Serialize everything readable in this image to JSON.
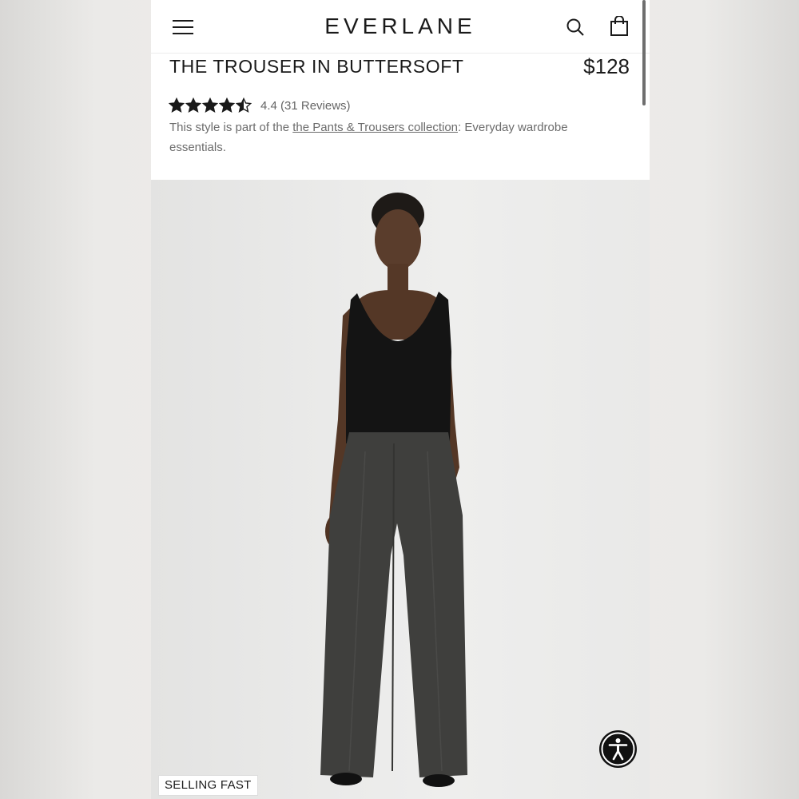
{
  "header": {
    "brand": "EVERLANE",
    "icons": [
      "hamburger-menu-icon",
      "search-icon",
      "shopping-bag-icon"
    ]
  },
  "product": {
    "title": "THE TROUSER IN BUTTERSOFT",
    "price": "$128",
    "rating_value": 4.4,
    "rating_max": 5,
    "rating_text": "4.4 (31 Reviews)",
    "collection_prefix": "This style is part of the ",
    "collection_link": "the Pants & Trousers collection",
    "collection_suffix": ": Everyday wardrobe essentials."
  },
  "image": {
    "badge": "SELLING FAST"
  },
  "colors": {
    "text_primary": "#1a1a1a",
    "text_secondary": "#6b6b6b",
    "accessibility_button": "#111111"
  }
}
